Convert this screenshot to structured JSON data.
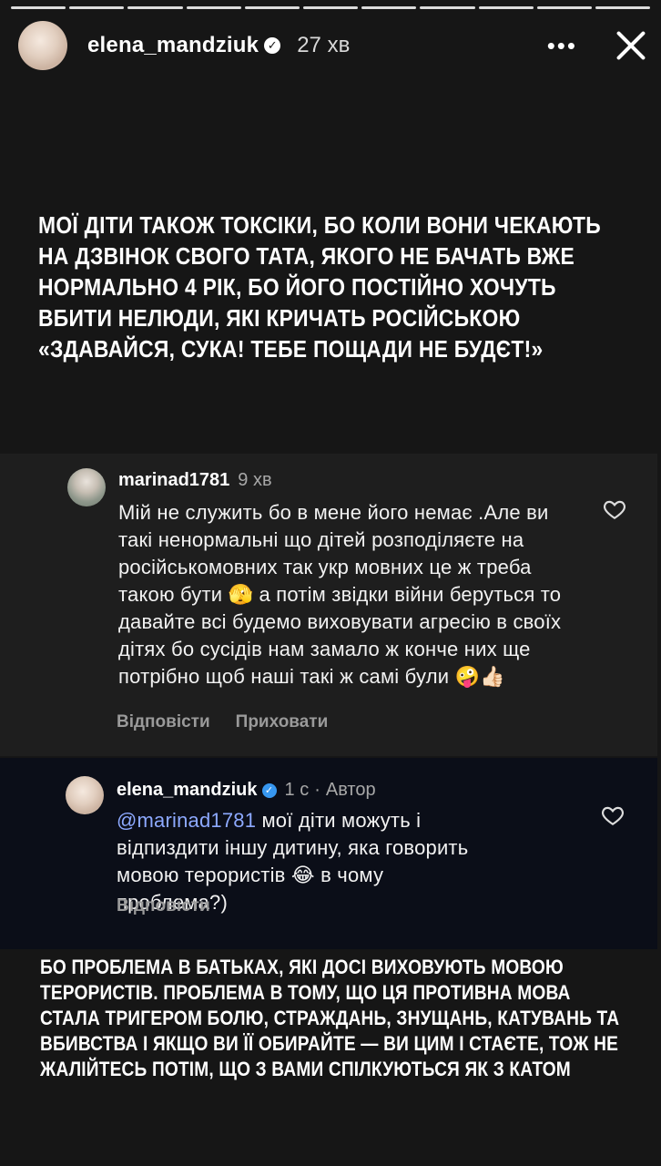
{
  "progress_segments": 11,
  "header": {
    "username": "elena_mandziuk",
    "time": "27 хв",
    "more_label": "•••",
    "verified_icon": "verified-badge-icon",
    "close_icon": "close-icon"
  },
  "story": {
    "text": "МОЇ ДІТИ ТАКОЖ ТОКСІКИ, БО КОЛИ ВОНИ ЧЕКАЮТЬ НА ДЗВІНОК СВОГО ТАТА, ЯКОГО НЕ БАЧАТЬ ВЖЕ НОРМАЛЬНО 4 РІК, БО ЙОГО ПОСТІЙНО ХОЧУТЬ ВБИТИ НЕЛЮДИ, ЯКІ КРИЧАТЬ РОСІЙСЬКОЮ «ЗДАВАЙСЯ, СУКА! ТЕБЕ ПОЩАДИ НЕ БУДЄТ!»"
  },
  "comments": [
    {
      "username": "marinad1781",
      "time": "9 хв",
      "text": "Мій не служить бо в мене його немає .Але ви такі ненормальні що дітей розподіляєте на російськомовних так укр мовних це ж треба такою бути 🫣 а потім звідки війни беруться то давайте всі будемо виховувати агресію в своїх дітях бо сусідів нам замало ж конче них ще потрібно щоб наші такі ж самі були 🤪👍🏻",
      "reply_label": "Відповісти",
      "hide_label": "Приховати"
    },
    {
      "username": "elena_mandziuk",
      "time": "1 с",
      "author_label": "Автор",
      "mention": "@marinad1781",
      "text": " мої діти можуть і відпиздити іншу дитину, яка говорить мовою терористів 😂 в чому проблема?)",
      "reply_label": "Відповісти"
    }
  ],
  "bottom": {
    "text": "БО ПРОБЛЕМА В БАТЬКАХ, ЯКІ ДОСІ ВИХОВУЮТЬ МОВОЮ ТЕРОРИСТІВ. ПРОБЛЕМА В ТОМУ, ЩО ЦЯ ПРОТИВНА МОВА СТАЛА ТРИГЕРОМ БОЛЮ, СТРАЖДАНЬ, ЗНУЩАНЬ, КАТУВАНЬ ТА ВБИВСТВА І ЯКЩО ВИ ЇЇ ОБИРАЙТЕ — ВИ ЦИМ І СТАЄТЕ, ТОЖ НЕ ЖАЛІЙТЕСЬ ПОТІМ, ЩО З ВАМИ СПІЛКУЮТЬСЯ ЯК З КАТОМ"
  }
}
